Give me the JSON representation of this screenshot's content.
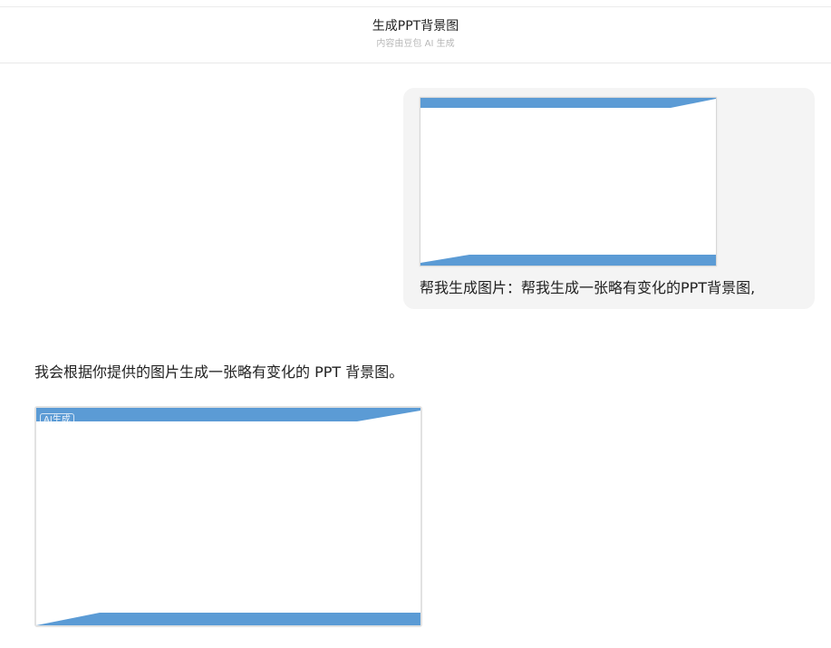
{
  "header": {
    "title": "生成PPT背景图",
    "subtitle": "内容由豆包 AI 生成"
  },
  "conversation": {
    "user_message": {
      "text": "帮我生成图片：帮我生成一张略有变化的PPT背景图,",
      "attachment_icon": "image-thumbnail"
    },
    "assistant_message": {
      "text": "我会根据你提供的图片生成一张略有变化的 PPT 背景图。",
      "generated_image_badge": "AI生成"
    }
  },
  "colors": {
    "accent_blue": "#5b9bd5",
    "bubble_bg": "#f4f4f4"
  }
}
